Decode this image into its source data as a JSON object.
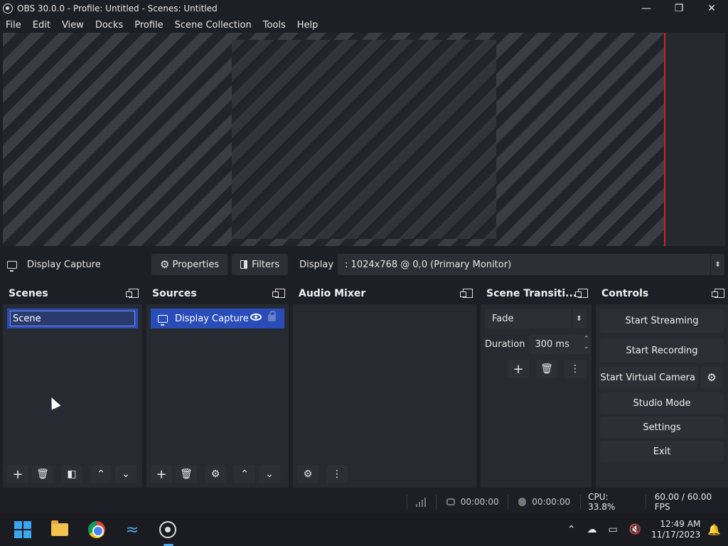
{
  "window": {
    "title": "OBS 30.0.0 - Profile: Untitled - Scenes: Untitled",
    "minimize": "—",
    "maximize": "❐",
    "close": "✕"
  },
  "menu": [
    "File",
    "Edit",
    "View",
    "Docks",
    "Profile",
    "Scene Collection",
    "Tools",
    "Help"
  ],
  "source_toolbar": {
    "current_source": "Display Capture",
    "properties_label": "Properties",
    "filters_label": "Filters",
    "display_label": "Display",
    "display_value": ": 1024x768 @ 0,0 (Primary Monitor)"
  },
  "docks": {
    "scenes": {
      "title": "Scenes",
      "items": [
        "Scene"
      ]
    },
    "sources": {
      "title": "Sources",
      "items": [
        "Display Capture"
      ]
    },
    "audio_mixer": {
      "title": "Audio Mixer"
    },
    "transitions": {
      "title": "Scene Transiti...",
      "selected": "Fade",
      "duration_label": "Duration",
      "duration_value": "300 ms"
    },
    "controls": {
      "title": "Controls",
      "start_streaming": "Start Streaming",
      "start_recording": "Start Recording",
      "start_virtual_camera": "Start Virtual Camera",
      "studio_mode": "Studio Mode",
      "settings": "Settings",
      "exit": "Exit"
    }
  },
  "status": {
    "live_time": "00:00:00",
    "rec_time": "00:00:00",
    "cpu": "CPU: 33.8%",
    "fps": "60.00 / 60.00 FPS"
  },
  "taskbar": {
    "time": "12:49 AM",
    "date": "11/17/2023",
    "apps": [
      "windows-start-icon",
      "file-explorer-icon",
      "chrome-icon",
      "dolphin-icon",
      "obs-icon"
    ]
  },
  "colors": {
    "background": "#1d1f26",
    "dock": "#272a31",
    "button": "#2c2f36",
    "selection": "#284cb8",
    "preview_edge": "#d21f25"
  }
}
